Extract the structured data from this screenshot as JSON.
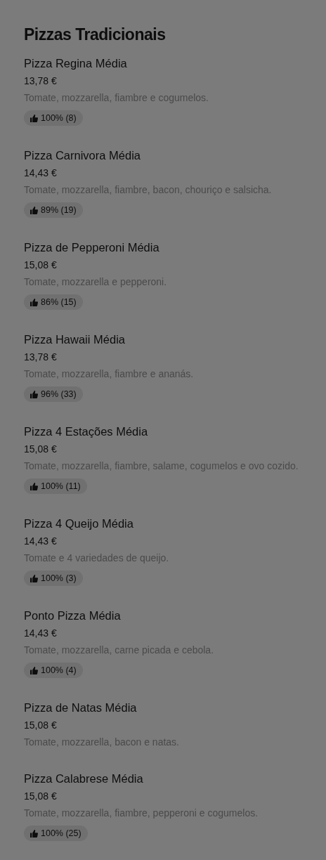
{
  "section": {
    "title": "Pizzas Tradicionais"
  },
  "items": [
    {
      "name": "Pizza Regina Média",
      "price": "13,78 €",
      "description": "Tomate, mozzarella, fiambre e cogumelos.",
      "rating": "100% (8)"
    },
    {
      "name": "Pizza Carnivora Média",
      "price": "14,43 €",
      "description": "Tomate, mozzarella, fiambre, bacon, chouriço e salsicha.",
      "rating": "89% (19)"
    },
    {
      "name": "Pizza de Pepperoni Média",
      "price": "15,08 €",
      "description": "Tomate, mozzarella e pepperoni.",
      "rating": "86% (15)"
    },
    {
      "name": "Pizza Hawaii Média",
      "price": "13,78 €",
      "description": "Tomate, mozzarella, fiambre e ananás.",
      "rating": "96% (33)"
    },
    {
      "name": "Pizza 4 Estações Média",
      "price": "15,08 €",
      "description": "Tomate, mozzarella, fiambre, salame, cogumelos e ovo cozido.",
      "rating": "100% (11)"
    },
    {
      "name": "Pizza 4 Queijo Média",
      "price": "14,43 €",
      "description": "Tomate e 4 variedades de queijo.",
      "rating": "100% (3)"
    },
    {
      "name": "Ponto Pizza Média",
      "price": "14,43 €",
      "description": "Tomate, mozzarella, carne picada e cebola.",
      "rating": "100% (4)"
    },
    {
      "name": "Pizza de Natas Média",
      "price": "15,08 €",
      "description": "Tomate, mozzarella, bacon e natas."
    },
    {
      "name": "Pizza Calabrese Média",
      "price": "15,08 €",
      "description": "Tomate, mozzarella, fiambre, pepperoni e cogumelos.",
      "rating": "100% (25)"
    }
  ]
}
